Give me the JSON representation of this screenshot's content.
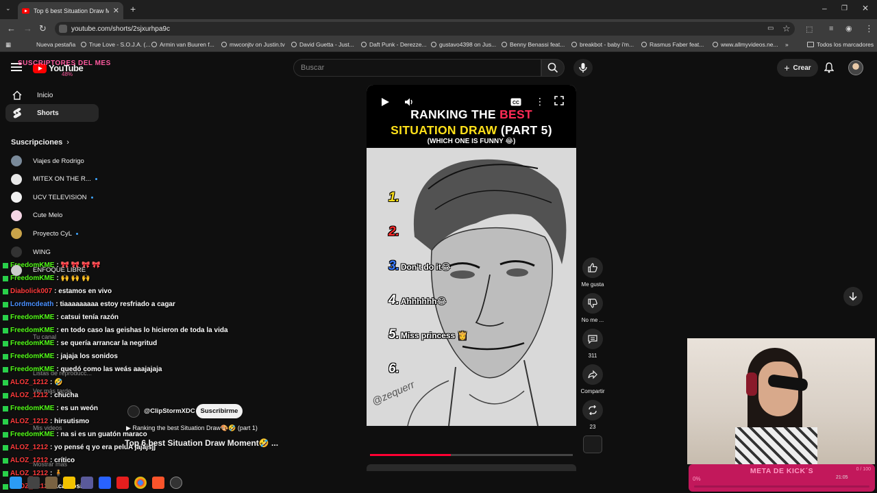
{
  "browser": {
    "tab_title": "Top 6 best Situation Draw Moment",
    "url": "youtube.com/shorts/2sjxurhpa9c",
    "bookmarks": [
      "Nueva pestaña",
      "True Love - S.O.J.A. (...",
      "Armin van Buuren f...",
      "mwconjtv on Justin.tv",
      "David Guetta - Just...",
      "Daft Punk - Derezze...",
      "gustavo4398 on Jus...",
      "Benny Benassi feat...",
      "breakbot - baby i'm...",
      "Rasmus Faber feat...",
      "www.allmyvideos.ne..."
    ],
    "all_bookmarks": "Todos los marcadores"
  },
  "header": {
    "logo": "YouTube",
    "subs_goal": "SUSCRIPTORES DEL MES",
    "subs_goal_pct": "48%",
    "search_placeholder": "Buscar",
    "create_label": "Crear"
  },
  "sidebar": {
    "items": [
      {
        "label": "Inicio"
      },
      {
        "label": "Shorts"
      }
    ],
    "subscriptions_title": "Suscripciones",
    "subscriptions": [
      {
        "name": "Viajes de Rodrigo",
        "color": "#7a8a9a",
        "live": false
      },
      {
        "name": "MITEX ON THE R...",
        "color": "#e8e8e8",
        "live": true
      },
      {
        "name": "UCV TELEVISION",
        "color": "#f2f2f2",
        "live": true
      },
      {
        "name": "Cute Melo",
        "color": "#f5d5e5",
        "live": false
      },
      {
        "name": "Proyecto CyL",
        "color": "#c9a34a",
        "live": true
      },
      {
        "name": "WING",
        "color": "#333333",
        "live": false
      },
      {
        "name": "ENFOQUE LIBRE",
        "color": "#cccccc",
        "live": false
      }
    ],
    "ghost_items": [
      "Tu canal",
      "Listas de reproducc...",
      "Ver más tarde",
      "Mis videos",
      "Mostrar más"
    ]
  },
  "chat": [
    {
      "user": "FreedomKME",
      "color": "green",
      "msg": ": 🎀 🎀 🎀 🎀"
    },
    {
      "user": "FreedomKME",
      "color": "green",
      "msg": ": 🙌 🙌 🙌"
    },
    {
      "user": "Diabolick007",
      "color": "red",
      "msg": ": estamos en vivo"
    },
    {
      "user": "Lordmcdeath",
      "color": "blue",
      "msg": ": tiaaaaaaaaa estoy resfriado a cagar"
    },
    {
      "user": "FreedomKME",
      "color": "green",
      "msg": ": catsui tenía razón"
    },
    {
      "user": "FreedomKME",
      "color": "green",
      "msg": ": en todo caso las geishas lo hicieron de toda la vida"
    },
    {
      "user": "FreedomKME",
      "color": "green",
      "msg": ": se quería arrancar la negritud"
    },
    {
      "user": "FreedomKME",
      "color": "green",
      "msg": ": jajaja los sonidos"
    },
    {
      "user": "FreedomKME",
      "color": "green",
      "msg": ": quedó como las weás aaajajaja"
    },
    {
      "user": "ALOZ_1212",
      "color": "red",
      "msg": ": 🤣"
    },
    {
      "user": "ALOZ_1212",
      "color": "red",
      "msg": ": chucha"
    },
    {
      "user": "FreedomKME",
      "color": "green",
      "msg": ": es un weón"
    },
    {
      "user": "ALOZ_1212",
      "color": "red",
      "msg": ": hirsutismo"
    },
    {
      "user": "FreedomKME",
      "color": "green",
      "msg": ": na si es un guatón maraco"
    },
    {
      "user": "ALOZ_1212",
      "color": "red",
      "msg": ": yo pensé q yo era peluA jajajsjj"
    },
    {
      "user": "ALOZ_1212",
      "color": "red",
      "msg": ": crítico"
    },
    {
      "user": "ALOZ_1212",
      "color": "red",
      "msg": ": 🧍"
    },
    {
      "user": "ALOZ_1212",
      "color": "red",
      "msg": ": acantosis"
    }
  ],
  "short": {
    "title_line1_a": "RANKING THE ",
    "title_line1_b": "BEST",
    "title_line2_a": "SITUATION DRAW",
    "title_line2_b": " (PART 5)",
    "title_line3": "(WHICH ONE IS FUNNY 😂)",
    "ranks": [
      {
        "num": "1.",
        "text": "",
        "color": "#ffe11a"
      },
      {
        "num": "2.",
        "text": "",
        "color": "#ff2b2b"
      },
      {
        "num": "3.",
        "text": "Don't do it😂",
        "color": "#3b7bff"
      },
      {
        "num": "4.",
        "text": "Ahhhhhh😂",
        "color": "#ffffff"
      },
      {
        "num": "5.",
        "text": "Miss princess 👸",
        "color": "#ffffff"
      },
      {
        "num": "6.",
        "text": "",
        "color": "#ffffff"
      }
    ],
    "signature": "@zequerr",
    "progress": 0.4,
    "channel": "@ClipStormXDC",
    "subscribe": "Suscribirme",
    "playlist": "Ranking the best Situation Draw🎨🤣 (part 1)",
    "video_title": "Top 6 best Situation Draw Moment🤣 ..."
  },
  "actions": {
    "like": "Me gusta",
    "dislike": "No me ...",
    "comments": "311",
    "share": "Compartir",
    "remix": "23"
  },
  "kick_goal": {
    "title": "META DE KICK´S",
    "pct": "0%",
    "count": "0 / 100"
  },
  "clock": {
    "time": "21:05"
  }
}
